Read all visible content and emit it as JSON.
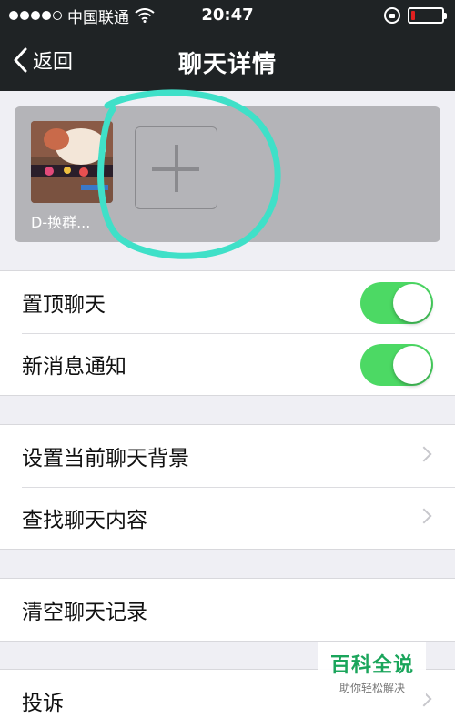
{
  "status_bar": {
    "carrier": "中国联通",
    "signal_dots": 5,
    "signal_filled": 4,
    "time": "20:47",
    "battery_level": 0.12,
    "battery_color": "#e02020"
  },
  "nav": {
    "back_label": "返回",
    "title": "聊天详情"
  },
  "members": {
    "items": [
      {
        "name": "D-换群..."
      }
    ],
    "add_icon": "plus-icon"
  },
  "groups": [
    {
      "rows": [
        {
          "label": "置顶聊天",
          "control": "toggle",
          "on": true
        },
        {
          "label": "新消息通知",
          "control": "toggle",
          "on": true
        }
      ]
    },
    {
      "rows": [
        {
          "label": "设置当前聊天背景",
          "control": "chevron"
        },
        {
          "label": "查找聊天内容",
          "control": "chevron"
        }
      ]
    },
    {
      "rows": [
        {
          "label": "清空聊天记录",
          "control": "none"
        }
      ]
    },
    {
      "rows": [
        {
          "label": "投诉",
          "control": "chevron"
        }
      ]
    }
  ],
  "watermark": {
    "main": "百科全说",
    "sub": "助你轻松解决"
  },
  "colors": {
    "toggle_on": "#4cd964",
    "nav_bg": "#1f2325",
    "page_bg": "#efeff4",
    "annotation_ring": "#3fe0c8"
  }
}
